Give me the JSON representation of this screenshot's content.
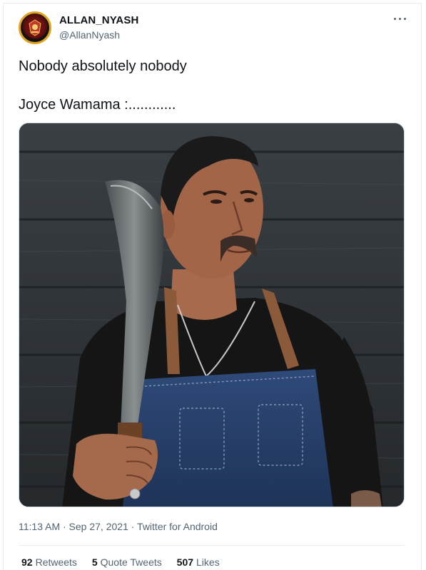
{
  "tweet": {
    "display_name": "ALLAN_NYASH",
    "handle": "@AllanNyash",
    "text_line_1": "Nobody absolutely nobody",
    "text_line_2": "Joyce Wamama :............",
    "timestamp": "11:13 AM · Sep 27, 2021 · Twitter for Android",
    "stats": {
      "retweets_count": "92",
      "retweets_label": "Retweets",
      "quotes_count": "5",
      "quotes_label": "Quote Tweets",
      "likes_count": "507",
      "likes_label": "Likes"
    }
  },
  "icons": {
    "more": "more-horizontal-icon",
    "avatar": "avatar-crest"
  },
  "colors": {
    "text_primary": "#0f1419",
    "text_secondary": "#536471",
    "border": "#e6ecf0",
    "avatar_ring": "#e3a321",
    "avatar_fill": "#9b1c1c"
  }
}
